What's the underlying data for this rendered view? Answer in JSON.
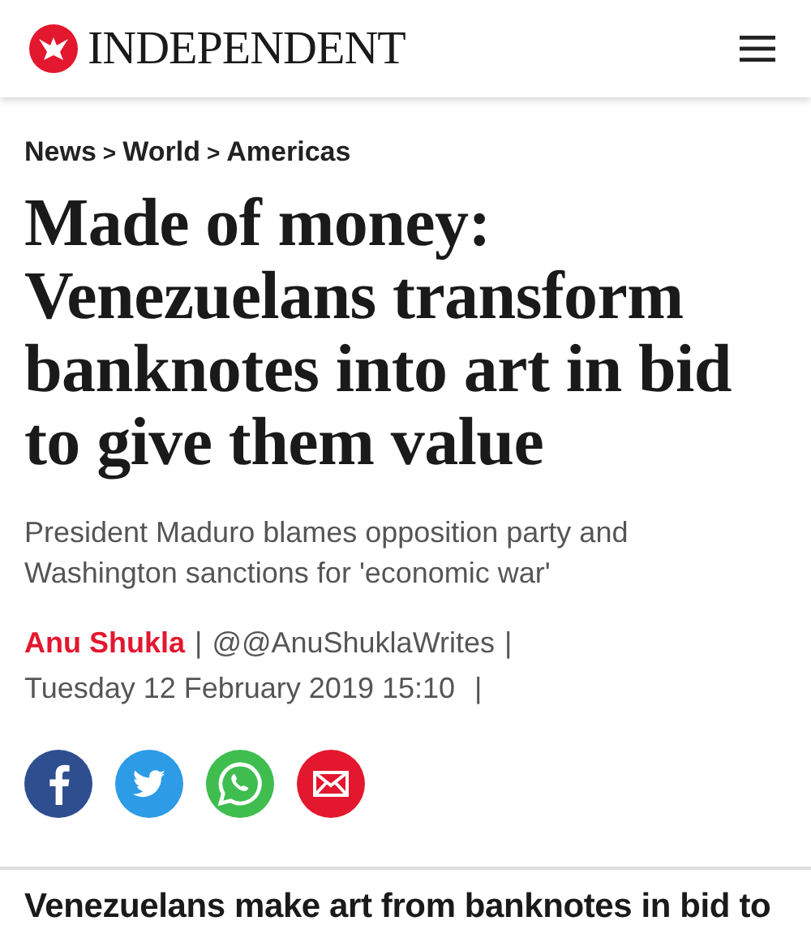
{
  "header": {
    "logo_text": "INDEPENDENT"
  },
  "breadcrumb": [
    {
      "label": "News",
      "separator": ">"
    },
    {
      "label": "World",
      "separator": ">"
    },
    {
      "label": "Americas"
    }
  ],
  "headline": "Made of money: Venezuelans transform banknotes into art in bid to give them value",
  "standfirst": "President Maduro blames opposition party and Washington sanctions for 'economic war'",
  "byline": {
    "author": "Anu Shukla",
    "separator_1": "|",
    "handle": "@@AnuShuklaWrites",
    "separator_2": "|",
    "date": "Tuesday 12 February 2019 15:10",
    "separator_3": "|"
  },
  "share": [
    {
      "kind": "facebook",
      "color": "#2e4e8f"
    },
    {
      "kind": "twitter",
      "color": "#2d9be6"
    },
    {
      "kind": "whatsapp",
      "color": "#3fbe4f"
    },
    {
      "kind": "email",
      "color": "#e3172e"
    }
  ],
  "subheading": "Venezuelans make art from banknotes in bid to"
}
